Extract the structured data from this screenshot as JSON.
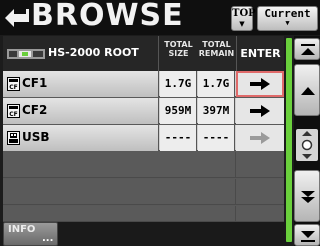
{
  "header": {
    "title": "BROWSE",
    "top_label": "TOP",
    "current_label": "Current"
  },
  "table": {
    "path_label": "HS-2000 ROOT",
    "col_total_size": [
      "TOTAL",
      "SIZE"
    ],
    "col_total_remain": [
      "TOTAL",
      "REMAIN"
    ],
    "col_enter": "ENTER",
    "rows": [
      {
        "name": "CF1",
        "size": "1.7G",
        "remain": "1.7G",
        "icon": "cf-card-icon",
        "enabled": true,
        "selected": true
      },
      {
        "name": "CF2",
        "size": "959M",
        "remain": "397M",
        "icon": "cf-card-icon",
        "enabled": true,
        "selected": false
      },
      {
        "name": "USB",
        "size": "----",
        "remain": "----",
        "icon": "usb-icon",
        "enabled": false,
        "selected": false
      }
    ]
  },
  "footer": {
    "info_label": "INFO",
    "info_dots": "..."
  },
  "colors": {
    "accent_green": "#6ad03c",
    "selection_border": "#e06a6a",
    "enabled_arrow": "#000000",
    "disabled_arrow": "#9a9a9a"
  }
}
